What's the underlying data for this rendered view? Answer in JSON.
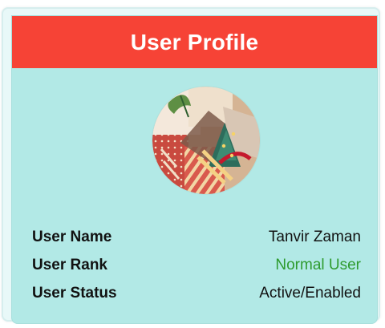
{
  "header": {
    "title": "User Profile"
  },
  "profile": {
    "avatar_icon": "profile-photo-avatar",
    "rows": [
      {
        "label": "User Name",
        "value": "Tanvir Zaman"
      },
      {
        "label": "User Rank",
        "value": "Normal User"
      },
      {
        "label": "User Status",
        "value": "Active/Enabled"
      }
    ]
  },
  "colors": {
    "header_bg": "#f64336",
    "card_bg": "#b2e9e6",
    "rank_value": "#2e9b2e"
  }
}
